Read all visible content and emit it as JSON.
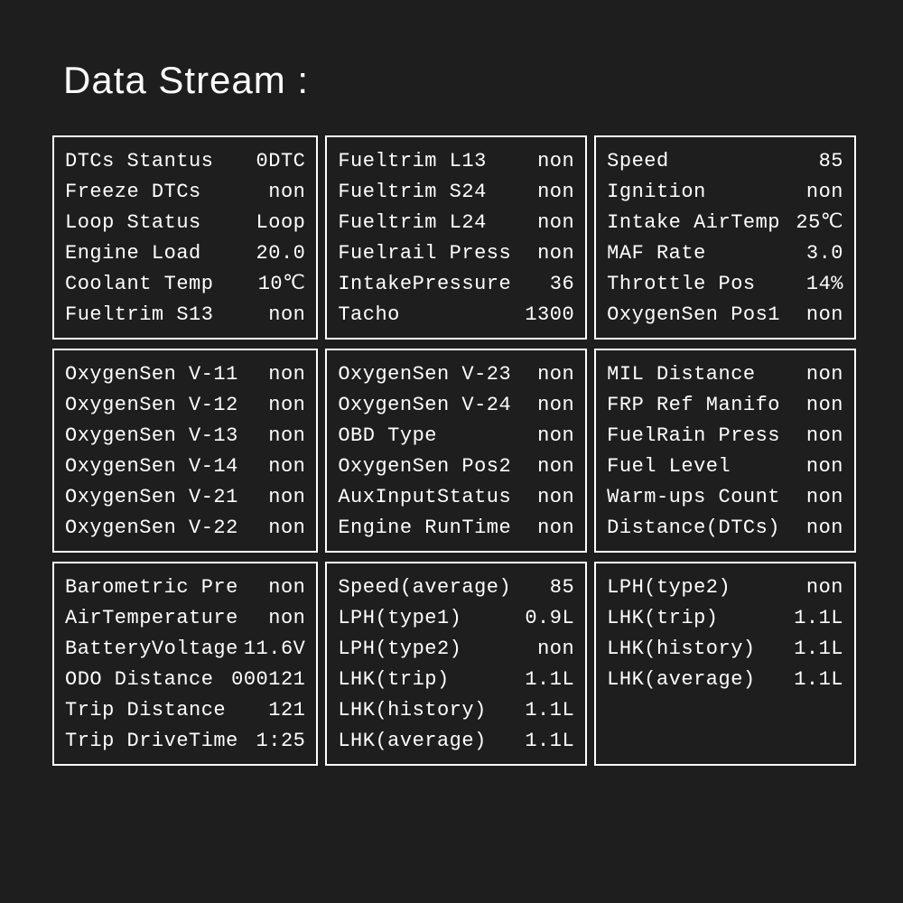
{
  "title": "Data Stream :",
  "panels": [
    {
      "rows": [
        {
          "label": "DTCs  Stantus",
          "value": "0DTC"
        },
        {
          "label": "Freeze DTCs",
          "value": "non"
        },
        {
          "label": "Loop  Status",
          "value": "Loop"
        },
        {
          "label": "Engine Load",
          "value": "20.0"
        },
        {
          "label": "Coolant  Temp",
          "value": "10℃"
        },
        {
          "label": "Fueltrim S13",
          "value": "non"
        }
      ]
    },
    {
      "rows": [
        {
          "label": "Fueltrim L13",
          "value": "non"
        },
        {
          "label": "Fueltrim S24",
          "value": "non"
        },
        {
          "label": "Fueltrim L24",
          "value": "non"
        },
        {
          "label": "Fuelrail Press",
          "value": "non"
        },
        {
          "label": "IntakePressure",
          "value": "36"
        },
        {
          "label": "Tacho",
          "value": "1300"
        }
      ]
    },
    {
      "rows": [
        {
          "label": "Speed",
          "value": "85"
        },
        {
          "label": "Ignition",
          "value": "non"
        },
        {
          "label": "Intake AirTemp",
          "value": "25℃"
        },
        {
          "label": "MAF Rate",
          "value": "3.0"
        },
        {
          "label": "Throttle Pos",
          "value": "14%"
        },
        {
          "label": "OxygenSen Pos1",
          "value": "non"
        }
      ]
    },
    {
      "rows": [
        {
          "label": "OxygenSen V-11",
          "value": "non"
        },
        {
          "label": "OxygenSen V-12",
          "value": "non"
        },
        {
          "label": "OxygenSen V-13",
          "value": "non"
        },
        {
          "label": "OxygenSen V-14",
          "value": "non"
        },
        {
          "label": "OxygenSen V-21",
          "value": "non"
        },
        {
          "label": "OxygenSen V-22",
          "value": "non"
        }
      ]
    },
    {
      "rows": [
        {
          "label": "OxygenSen V-23",
          "value": "non"
        },
        {
          "label": "OxygenSen V-24",
          "value": "non"
        },
        {
          "label": "OBD Type",
          "value": "non"
        },
        {
          "label": "OxygenSen Pos2",
          "value": "non"
        },
        {
          "label": "AuxInputStatus",
          "value": "non"
        },
        {
          "label": "Engine RunTime",
          "value": "non"
        }
      ]
    },
    {
      "rows": [
        {
          "label": "MIL   Distance",
          "value": "non"
        },
        {
          "label": "FRP Ref Manifo",
          "value": "non"
        },
        {
          "label": "FuelRain Press",
          "value": "non"
        },
        {
          "label": "Fuel Level",
          "value": "non"
        },
        {
          "label": "Warm-ups Count",
          "value": "non"
        },
        {
          "label": "Distance(DTCs)",
          "value": "non"
        }
      ]
    },
    {
      "rows": [
        {
          "label": "Barometric Pre",
          "value": "non"
        },
        {
          "label": "AirTemperature",
          "value": "non"
        },
        {
          "label": "BatteryVoltage",
          "value": "11.6V"
        },
        {
          "label": "ODO Distance",
          "value": "000121"
        },
        {
          "label": "Trip Distance",
          "value": "121"
        },
        {
          "label": "Trip DriveTime",
          "value": "1:25"
        }
      ]
    },
    {
      "rows": [
        {
          "label": "Speed(average)",
          "value": "85"
        },
        {
          "label": "LPH(type1)",
          "value": "0.9L"
        },
        {
          "label": "LPH(type2)",
          "value": "non"
        },
        {
          "label": "LHK(trip)",
          "value": "1.1L"
        },
        {
          "label": "LHK(history)",
          "value": "1.1L"
        },
        {
          "label": "LHK(average)",
          "value": "1.1L"
        }
      ]
    },
    {
      "rows": [
        {
          "label": "LPH(type2)",
          "value": "non"
        },
        {
          "label": "LHK(trip)",
          "value": "1.1L"
        },
        {
          "label": "LHK(history)",
          "value": "1.1L"
        },
        {
          "label": "LHK(average)",
          "value": "1.1L"
        }
      ]
    }
  ]
}
